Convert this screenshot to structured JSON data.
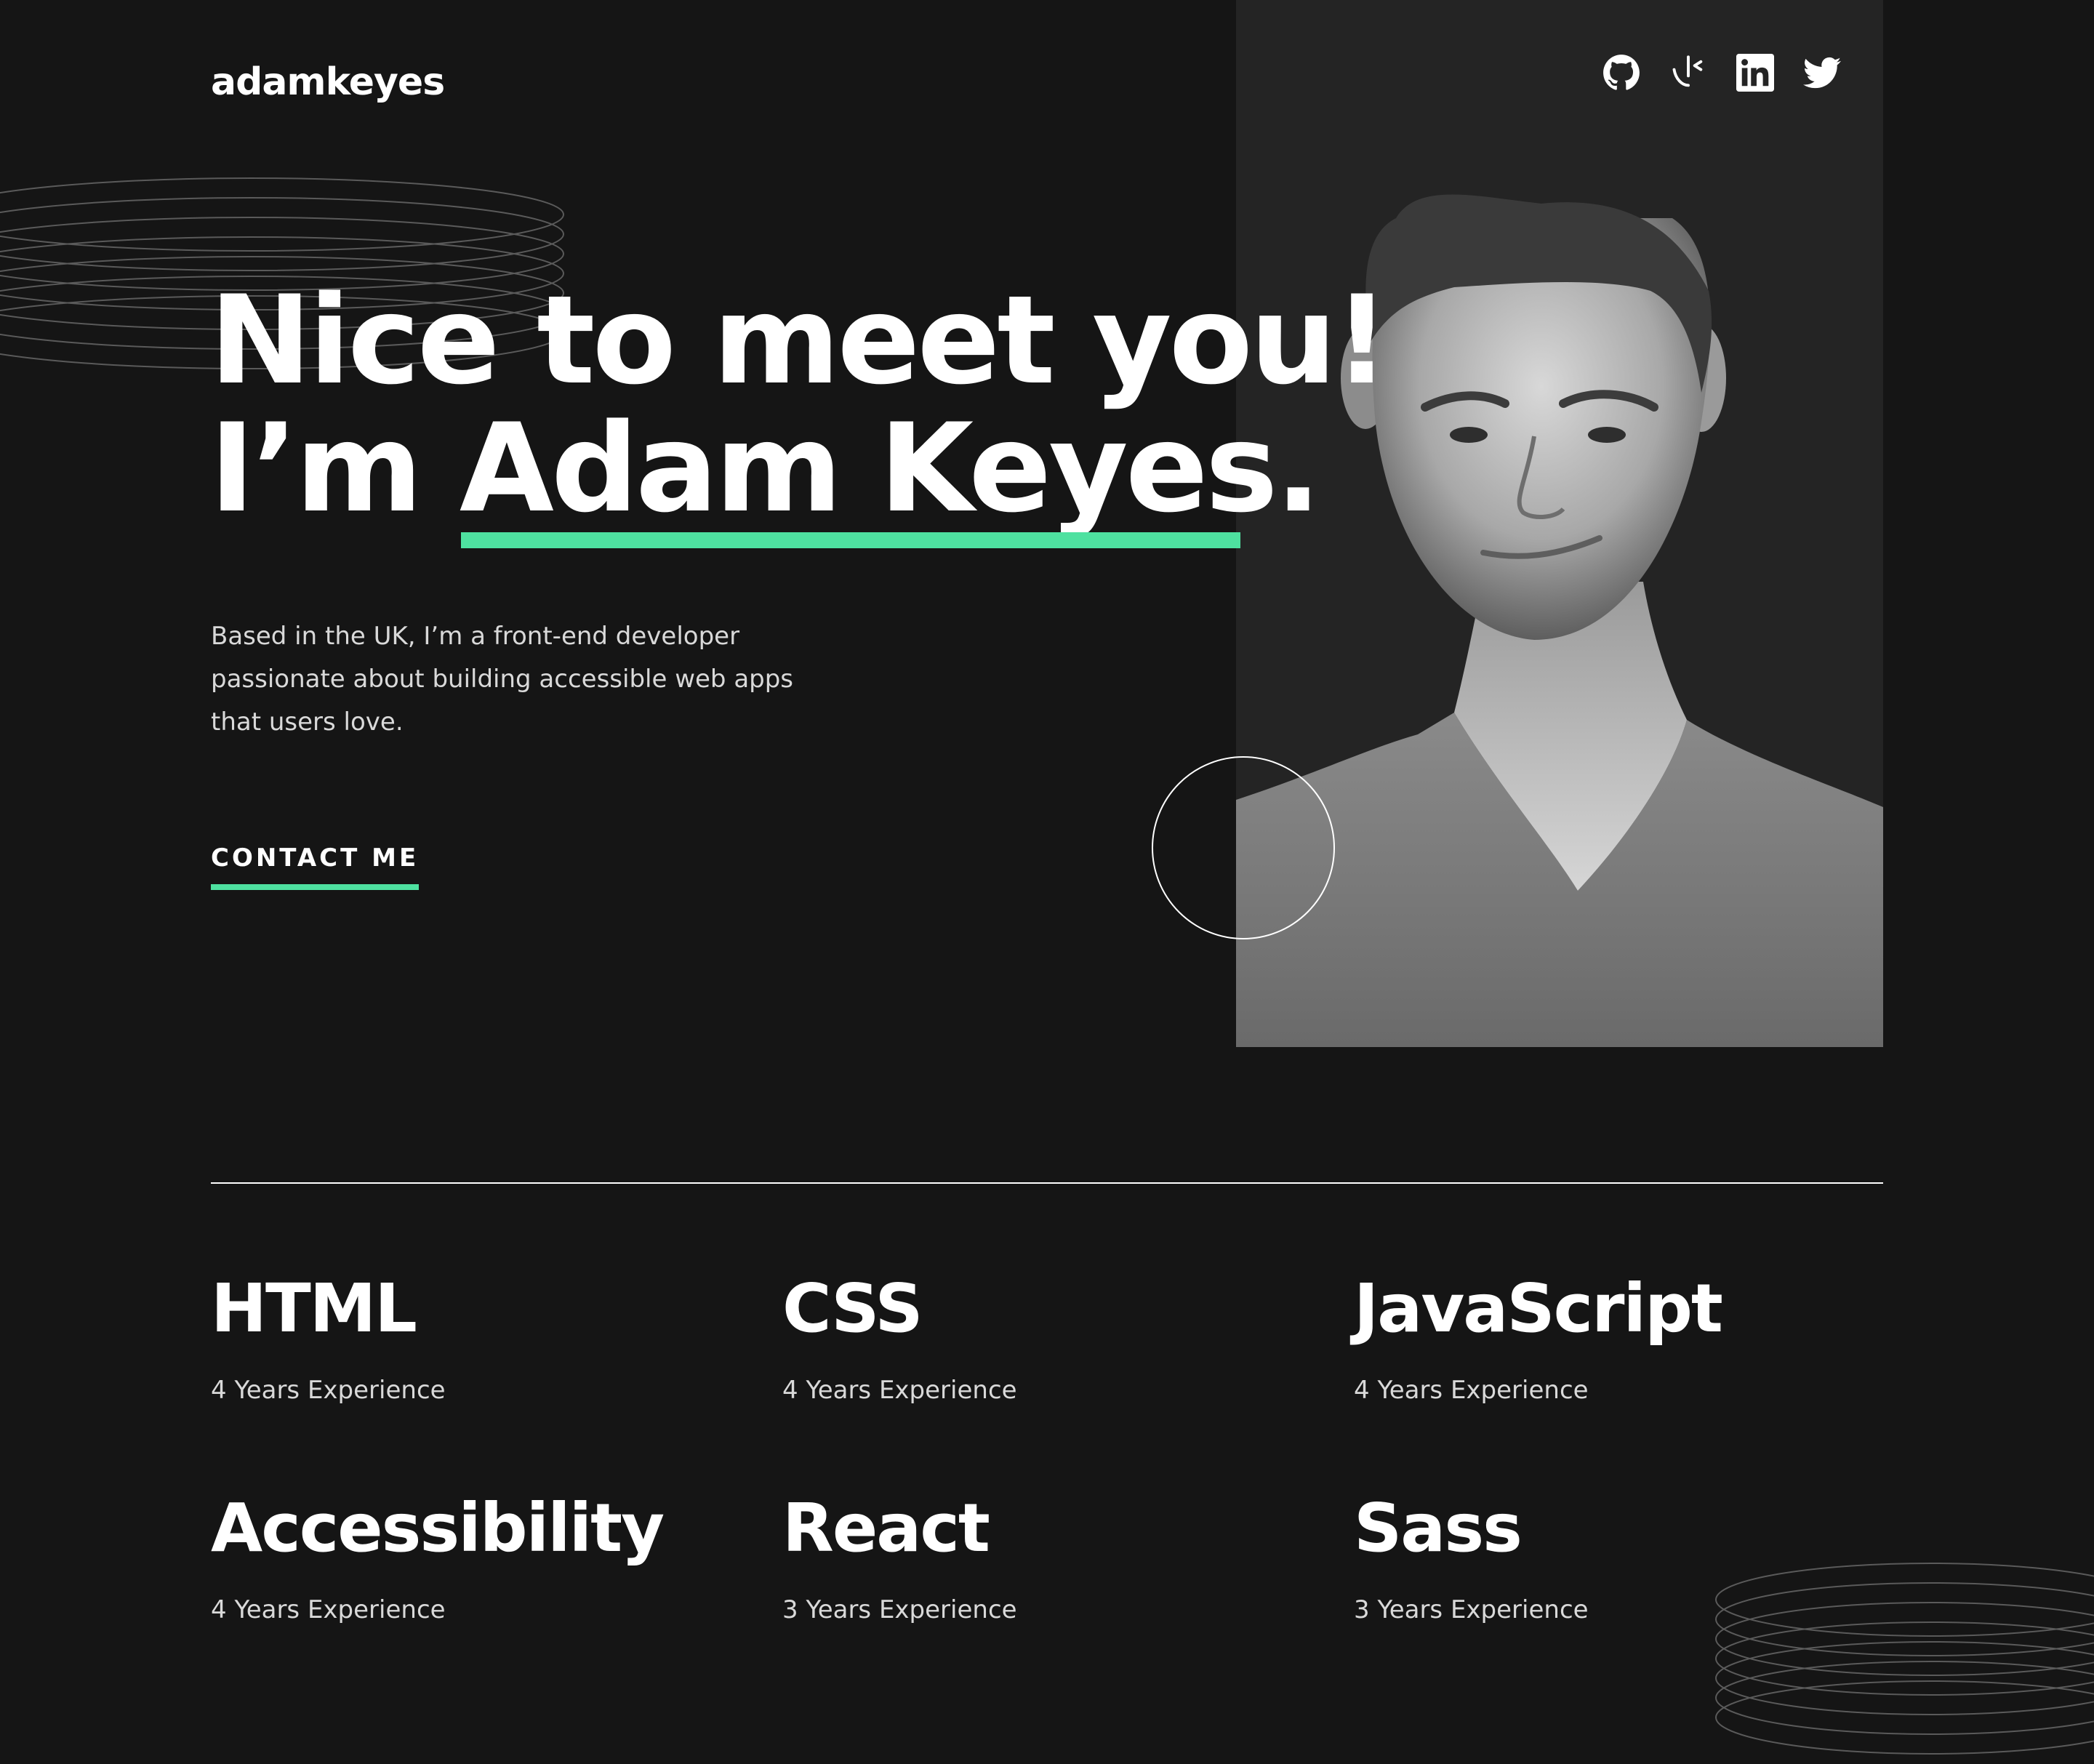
{
  "header": {
    "logo": "adamkeyes",
    "socials": [
      {
        "name": "GitHub",
        "icon": "github-icon"
      },
      {
        "name": "Frontend Mentor",
        "icon": "frontend-mentor-icon"
      },
      {
        "name": "LinkedIn",
        "icon": "linkedin-icon"
      },
      {
        "name": "Twitter",
        "icon": "twitter-icon"
      }
    ]
  },
  "hero": {
    "title_line1": "Nice to meet you!",
    "title_prefix": "I’m ",
    "title_name": "Adam Keyes",
    "title_suffix": ".",
    "description": "Based in the UK, I’m a front-end developer passionate about building accessible web apps that users love.",
    "cta_label": "CONTACT ME",
    "portrait": "Portrait photo of Adam Keyes"
  },
  "skills": [
    {
      "name": "HTML",
      "experience": "4 Years Experience"
    },
    {
      "name": "CSS",
      "experience": "4 Years Experience"
    },
    {
      "name": "JavaScript",
      "experience": "4 Years Experience"
    },
    {
      "name": "Accessibility",
      "experience": "4 Years Experience"
    },
    {
      "name": "React",
      "experience": "3 Years Experience"
    },
    {
      "name": "Sass",
      "experience": "3 Years Experience"
    }
  ],
  "colors": {
    "background": "#151515",
    "panel": "#242424",
    "accent": "#4ee1a0",
    "text": "#ffffff",
    "muted_text": "#d9d9d9"
  }
}
